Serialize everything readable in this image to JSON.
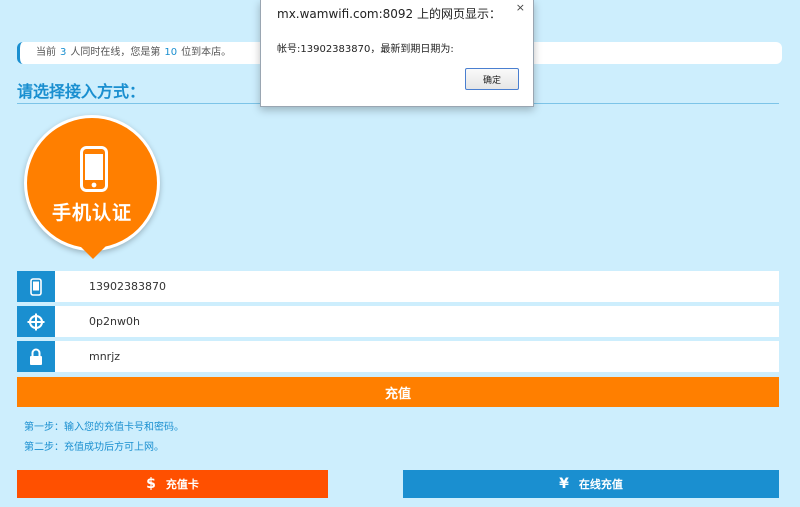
{
  "status": {
    "prefix": "当前",
    "online_count": "3",
    "middle": "人同时在线，您是第",
    "position": "10",
    "suffix": "位到本店。"
  },
  "section": {
    "title": "请选择接入方式："
  },
  "method": {
    "label": "手机认证",
    "icon": "phone-icon"
  },
  "fields": {
    "phone": {
      "value": "13902383870",
      "icon": "phone-icon"
    },
    "card_number": {
      "value": "0p2nw0h",
      "icon": "crosshair-icon"
    },
    "password": {
      "value": "mnrjz",
      "icon": "lock-icon"
    }
  },
  "actions": {
    "recharge_label": "充值",
    "card_recharge_label": "充值卡",
    "card_recharge_icon": "$",
    "online_recharge_label": "在线充值",
    "online_recharge_icon": "¥"
  },
  "steps": [
    "第一步：输入您的充值卡号和密码。",
    "第二步：充值成功后方可上网。"
  ],
  "alert": {
    "title": "mx.wamwifi.com:8092 上的网页显示：",
    "message": "帐号:13902383870，最新到期日期为:",
    "ok_label": "确定",
    "close_glyph": "×"
  },
  "colors": {
    "accent_blue": "#1a8fd0",
    "accent_orange": "#ff7f00",
    "card_button": "#ff5000",
    "background": "#cdeefd"
  }
}
